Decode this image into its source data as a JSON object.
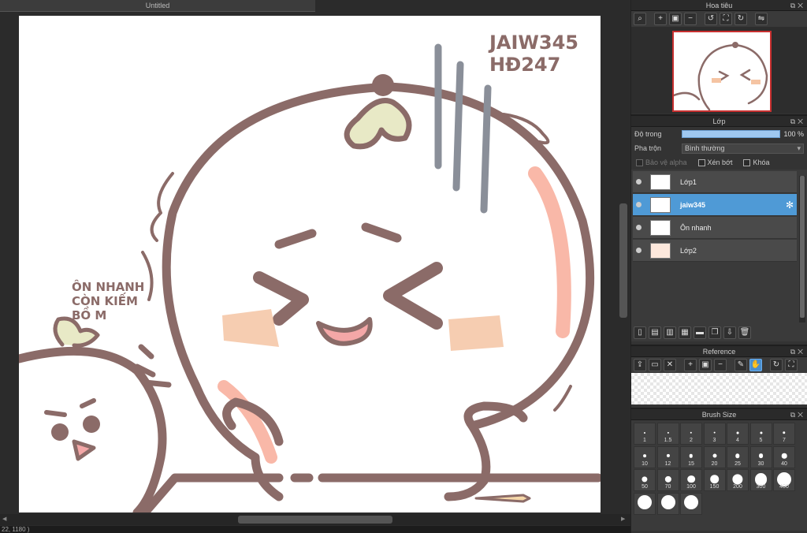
{
  "document": {
    "tab_title": "Untitled",
    "status_text": "22, 1180 )"
  },
  "canvas": {
    "text_top_right_line1": "JAIW345",
    "text_top_right_line2": "HĐ247",
    "text_left_line1": "ÔN NHANH",
    "text_left_line2": "CÒN KIẾM",
    "text_left_line3": "BỒ M"
  },
  "navigator": {
    "title": "Hoa tiêu"
  },
  "layers_panel": {
    "title": "Lớp",
    "opacity_label": "Độ trong",
    "opacity_value": "100 %",
    "opacity_fraction": 1.0,
    "blend_label": "Pha trộn",
    "blend_value": "Bình thường",
    "protect_alpha": "Bảo vệ alpha",
    "clipping": "Xén bớt",
    "lock": "Khóa",
    "layers": [
      {
        "name": "Lớp1",
        "selected": false
      },
      {
        "name": "jaiw345",
        "selected": true
      },
      {
        "name": "Ôn nhanh",
        "selected": false
      },
      {
        "name": "Lớp2",
        "selected": false
      }
    ]
  },
  "reference_panel": {
    "title": "Reference"
  },
  "brush_panel": {
    "title": "Brush Size",
    "sizes": [
      "1",
      "1.5",
      "2",
      "3",
      "4",
      "5",
      "7",
      "10",
      "12",
      "15",
      "20",
      "25",
      "30",
      "40",
      "50",
      "70",
      "100",
      "150",
      "200",
      "300",
      "400",
      "",
      "",
      ""
    ]
  },
  "colors": {
    "accent": "#4f9ad6",
    "line": "#8b6b68",
    "blush": "#f4a582"
  }
}
